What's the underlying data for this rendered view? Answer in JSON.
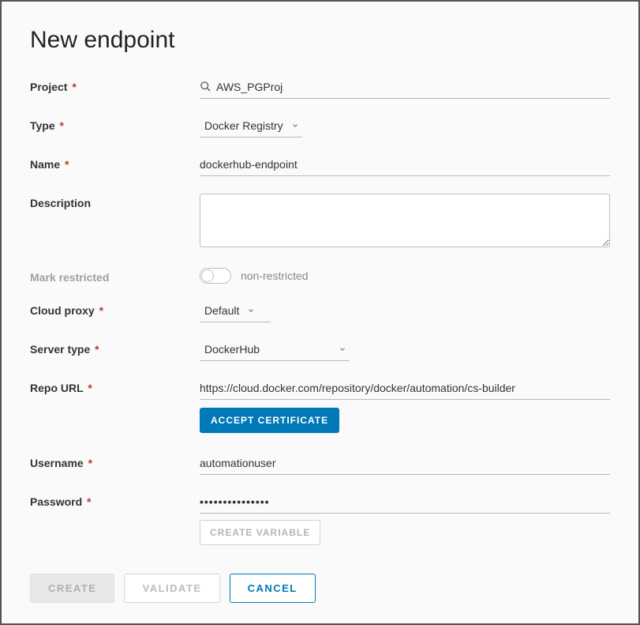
{
  "title": "New endpoint",
  "labels": {
    "project": "Project",
    "type": "Type",
    "name": "Name",
    "description": "Description",
    "mark_restricted": "Mark restricted",
    "cloud_proxy": "Cloud proxy",
    "server_type": "Server type",
    "repo_url": "Repo URL",
    "username": "Username",
    "password": "Password"
  },
  "fields": {
    "project": "AWS_PGProj",
    "type": "Docker Registry",
    "name": "dockerhub-endpoint",
    "description": "",
    "restricted_state": "non-restricted",
    "cloud_proxy": "Default",
    "server_type": "DockerHub",
    "repo_url": "https://cloud.docker.com/repository/docker/automation/cs-builder",
    "username": "automationuser",
    "password": "•••••••••••••••"
  },
  "buttons": {
    "accept_certificate": "ACCEPT CERTIFICATE",
    "create_variable": "CREATE VARIABLE",
    "create": "CREATE",
    "validate": "VALIDATE",
    "cancel": "CANCEL"
  }
}
